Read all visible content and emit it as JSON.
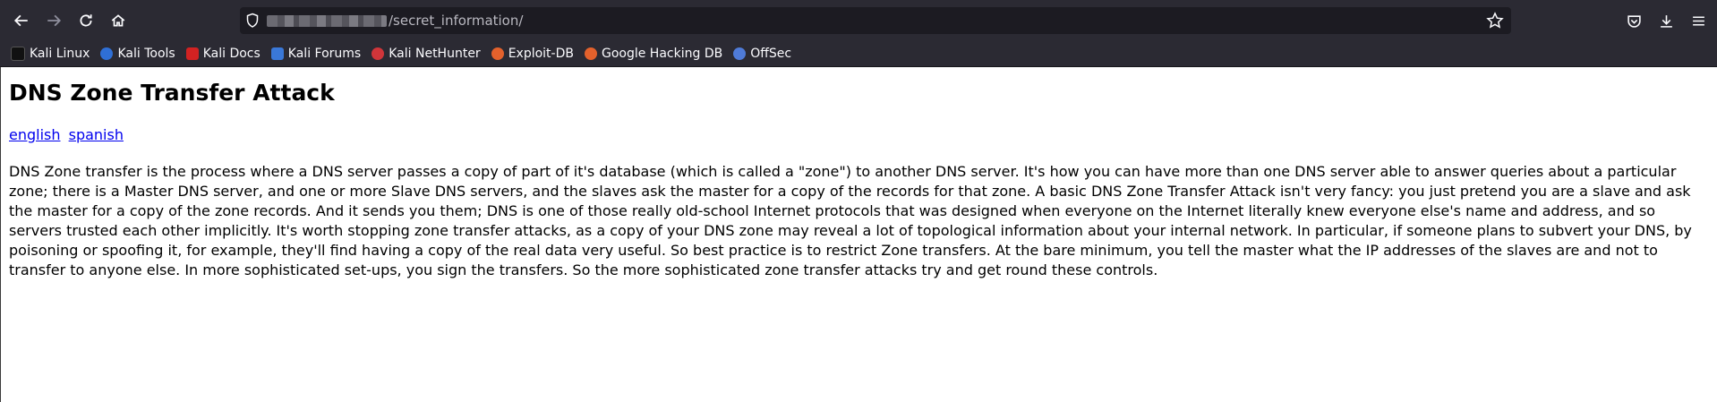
{
  "browser": {
    "url_path": "/secret_information/",
    "bookmarks": [
      {
        "label": "Kali Linux",
        "icon": "kali-dragon-icon",
        "color": "#1e1e1e"
      },
      {
        "label": "Kali Tools",
        "icon": "kali-tools-icon",
        "color": "#2f6fd6"
      },
      {
        "label": "Kali Docs",
        "icon": "kali-docs-icon",
        "color": "#d22222"
      },
      {
        "label": "Kali Forums",
        "icon": "kali-forums-icon",
        "color": "#3a78d8"
      },
      {
        "label": "Kali NetHunter",
        "icon": "kali-nethunter-icon",
        "color": "#d0353a"
      },
      {
        "label": "Exploit-DB",
        "icon": "exploit-db-icon",
        "color": "#e3612c"
      },
      {
        "label": "Google Hacking DB",
        "icon": "google-hacking-db-icon",
        "color": "#e3612c"
      },
      {
        "label": "OffSec",
        "icon": "offsec-icon",
        "color": "#4f7bd8"
      }
    ]
  },
  "page": {
    "title": "DNS Zone Transfer Attack",
    "languages": [
      "english",
      "spanish"
    ],
    "body": "DNS Zone transfer is the process where a DNS server passes a copy of part of it's database (which is called a \"zone\") to another DNS server. It's how you can have more than one DNS server able to answer queries about a particular zone; there is a Master DNS server, and one or more Slave DNS servers, and the slaves ask the master for a copy of the records for that zone. A basic DNS Zone Transfer Attack isn't very fancy: you just pretend you are a slave and ask the master for a copy of the zone records. And it sends you them; DNS is one of those really old-school Internet protocols that was designed when everyone on the Internet literally knew everyone else's name and address, and so servers trusted each other implicitly. It's worth stopping zone transfer attacks, as a copy of your DNS zone may reveal a lot of topological information about your internal network. In particular, if someone plans to subvert your DNS, by poisoning or spoofing it, for example, they'll find having a copy of the real data very useful. So best practice is to restrict Zone transfers. At the bare minimum, you tell the master what the IP addresses of the slaves are and not to transfer to anyone else. In more sophisticated set-ups, you sign the transfers. So the more sophisticated zone transfer attacks try and get round these controls."
  }
}
